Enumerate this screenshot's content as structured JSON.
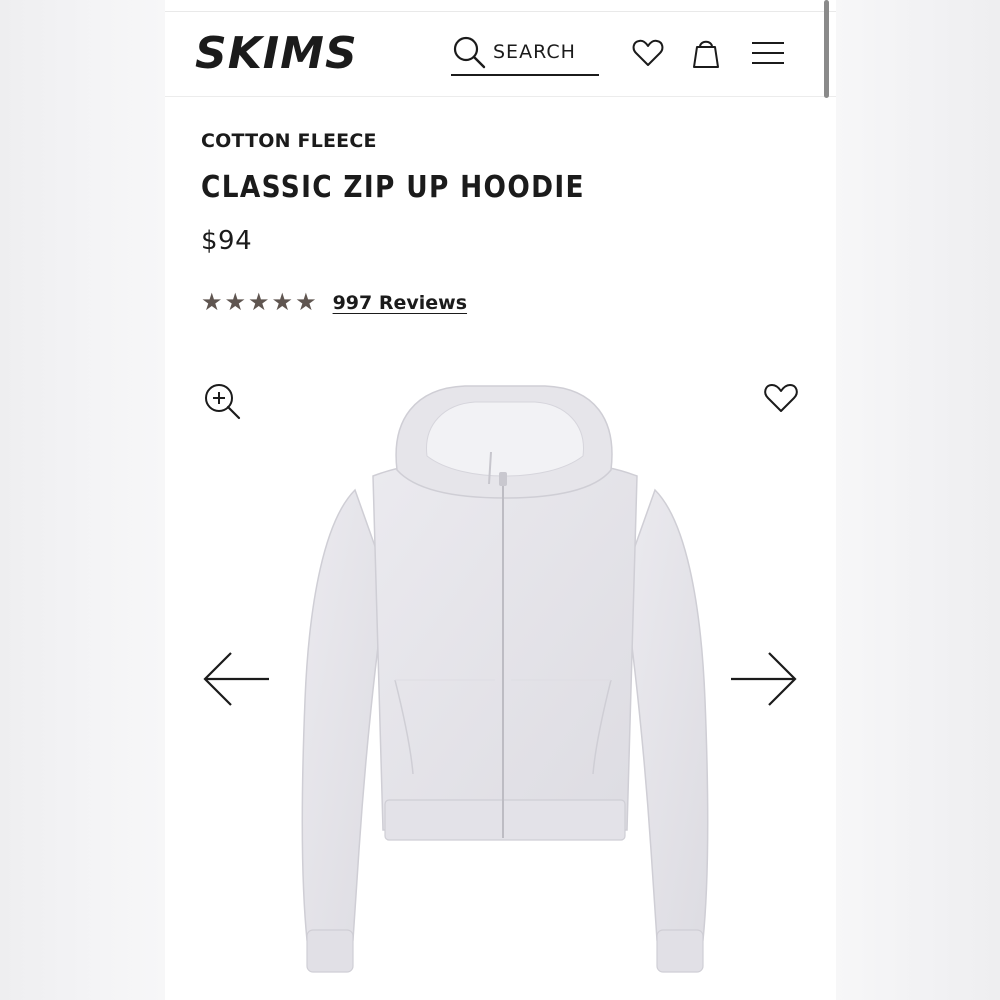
{
  "brand": {
    "logo_text": "SKIMS"
  },
  "header": {
    "search_label": "SEARCH",
    "icons": [
      "search-icon",
      "heart-icon",
      "shopping-bag-icon",
      "menu-icon"
    ]
  },
  "product": {
    "category": "COTTON FLEECE",
    "title": "CLASSIC ZIP UP HOODIE",
    "price": "$94",
    "rating": {
      "stars": 5,
      "max": 5,
      "color": "#5f5550"
    },
    "reviews_label": "997 Reviews",
    "image": {
      "subject": "heather grey zip-up hoodie",
      "color": "#e6e5ea"
    }
  },
  "gallery": {
    "icons": [
      "zoom-in-icon",
      "wishlist-heart-icon",
      "arrow-left-icon",
      "arrow-right-icon"
    ]
  },
  "colors": {
    "text": "#1b1b1b",
    "background": "#ffffff",
    "star": "#5f5550"
  }
}
